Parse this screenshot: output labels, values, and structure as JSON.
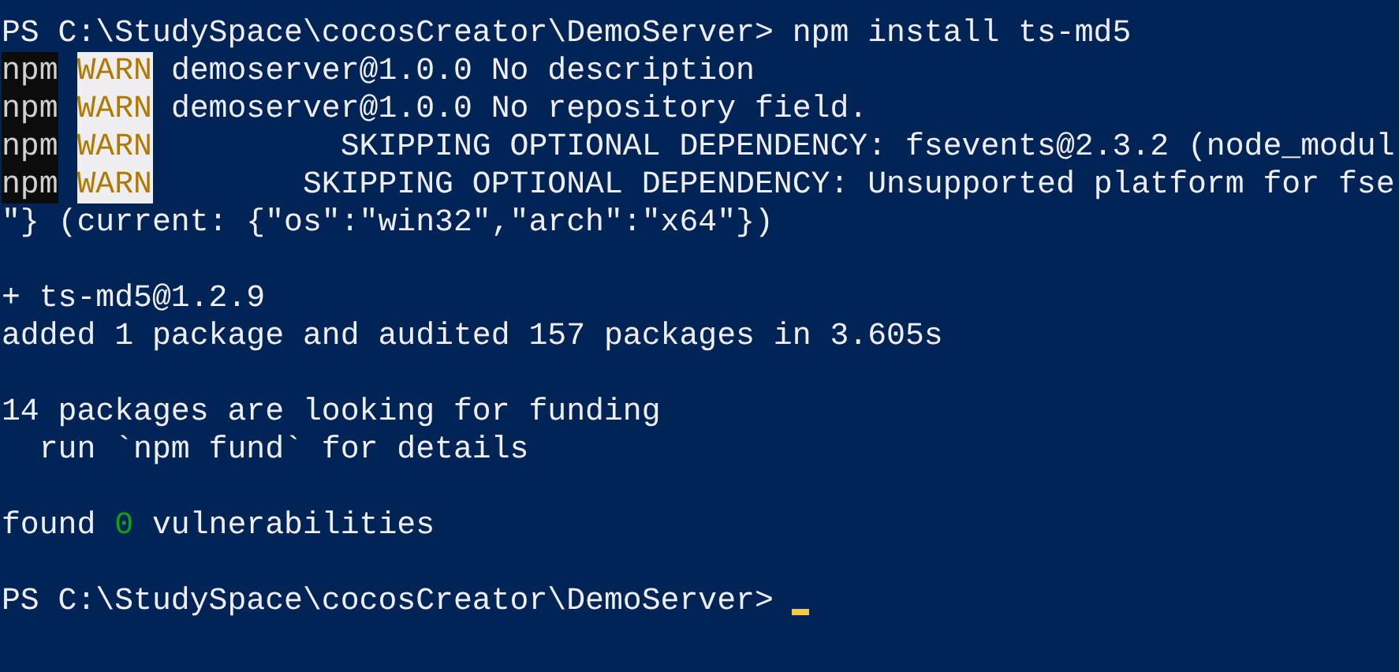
{
  "terminal": {
    "lines": [
      {
        "kind": "prompt",
        "prompt": "PS C:\\StudySpace\\cocosCreator\\DemoServer>",
        "command": "npm install ts-md5",
        "cursor": false
      },
      {
        "kind": "warn",
        "source": "npm",
        "level": "WARN",
        "message": "demoserver@1.0.0 No description"
      },
      {
        "kind": "warn",
        "source": "npm",
        "level": "WARN",
        "message": "demoserver@1.0.0 No repository field."
      },
      {
        "kind": "warn",
        "source": "npm",
        "level": "WARN",
        "message": "         SKIPPING OPTIONAL DEPENDENCY: fsevents@2.3.2 (node_modul"
      },
      {
        "kind": "warn",
        "source": "npm",
        "level": "WARN",
        "message": "       SKIPPING OPTIONAL DEPENDENCY: Unsupported platform for fse"
      },
      {
        "kind": "text",
        "text": "\"} (current: {\"os\":\"win32\",\"arch\":\"x64\"})"
      },
      {
        "kind": "blank"
      },
      {
        "kind": "text",
        "text": "+ ts-md5@1.2.9"
      },
      {
        "kind": "text",
        "text": "added 1 package and audited 157 packages in 3.605s"
      },
      {
        "kind": "blank"
      },
      {
        "kind": "text",
        "text": "14 packages are looking for funding"
      },
      {
        "kind": "text",
        "text": "  run `npm fund` for details"
      },
      {
        "kind": "blank"
      },
      {
        "kind": "found",
        "before": "found",
        "count": "0",
        "after": "vulnerabilities"
      },
      {
        "kind": "blank"
      },
      {
        "kind": "prompt",
        "prompt": "PS C:\\StudySpace\\cocosCreator\\DemoServer>",
        "cursor": true
      }
    ]
  }
}
